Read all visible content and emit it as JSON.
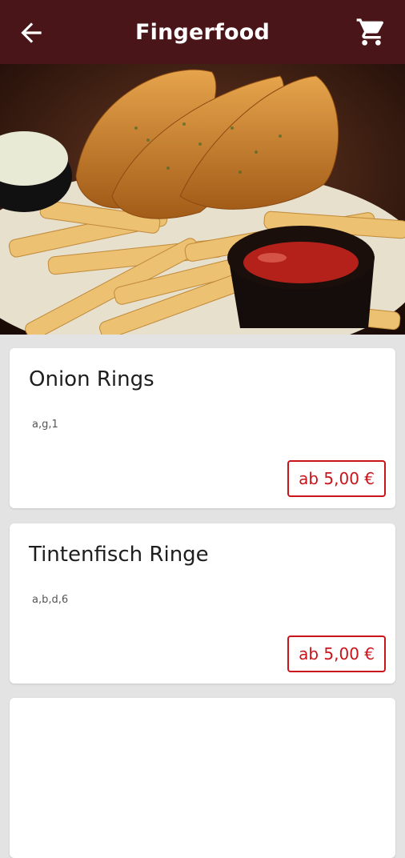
{
  "header": {
    "title": "Fingerfood",
    "back_icon": "arrow-left-icon",
    "cart_icon": "shopping-cart-icon",
    "color": "#4a1519"
  },
  "hero_image": {
    "subject": "fish-and-chips-photo"
  },
  "items": [
    {
      "name": "Onion Rings",
      "codes": "a,g,1",
      "price": "ab 5,00 €"
    },
    {
      "name": "Tintenfisch Ringe",
      "codes": "a,b,d,6",
      "price": "ab 5,00 €"
    }
  ],
  "accent_color": "#c8141a"
}
